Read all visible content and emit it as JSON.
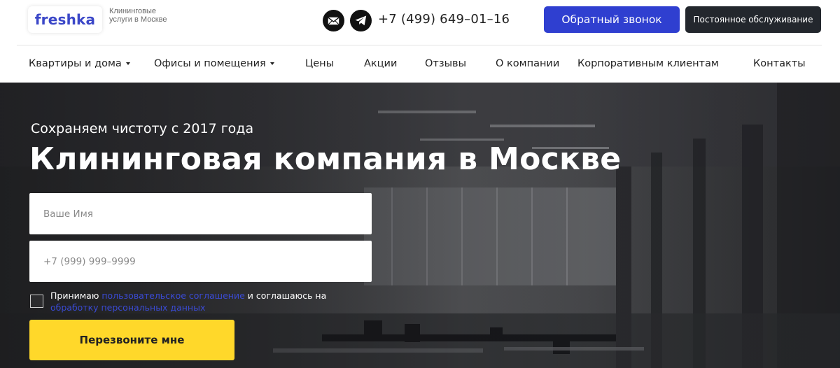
{
  "header": {
    "logo": "freshka",
    "tagline": "Клининговые услуги в Москве",
    "phone": "+7 (499) 649–01–16",
    "callback_button": "Обратный звонок",
    "service_button": "Постоянное обслуживание",
    "social": [
      "email-icon",
      "telegram-icon"
    ]
  },
  "nav": {
    "items": [
      {
        "label": "Квартиры и дома",
        "dropdown": true
      },
      {
        "label": "Офисы и помещения",
        "dropdown": true
      },
      {
        "label": "Цены",
        "dropdown": false
      },
      {
        "label": "Акции",
        "dropdown": false
      },
      {
        "label": "Отзывы",
        "dropdown": false
      },
      {
        "label": "О компании",
        "dropdown": false
      },
      {
        "label": "Корпоративным клиентам",
        "dropdown": false
      },
      {
        "label": "Контакты",
        "dropdown": false
      }
    ]
  },
  "hero": {
    "subtitle": "Сохраняем чистоту с 2017 года",
    "title": "Клининговая компания в Москве",
    "form": {
      "name_placeholder": "Ваше Имя",
      "phone_placeholder": "+7 (999) 999–9999",
      "consent_prefix": "Принимаю ",
      "consent_link1": "пользовательское соглашение",
      "consent_middle": " и соглашаюсь на ",
      "consent_link2": "обработку персональных данных",
      "submit": "Перезвоните мне"
    }
  },
  "colors": {
    "brand": "#3b47c8",
    "callback_bg": "#2f3fd0",
    "service_bg": "#23272d",
    "submit_bg": "#ffd82a",
    "link": "#3a4ad2"
  }
}
